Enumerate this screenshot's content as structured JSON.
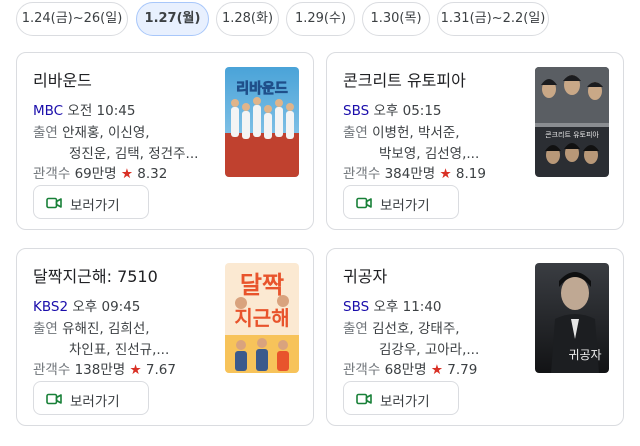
{
  "date_tabs": [
    {
      "label": "1.24(금)~26(일)",
      "active": false
    },
    {
      "label": "1.27(월)",
      "active": true
    },
    {
      "label": "1.28(화)",
      "active": false
    },
    {
      "label": "1.29(수)",
      "active": false
    },
    {
      "label": "1.30(목)",
      "active": false
    },
    {
      "label": "1.31(금)~2.2(일)",
      "active": false
    }
  ],
  "labels": {
    "cast": "출연",
    "audience": "관객수",
    "watch": "보러가기",
    "star": "★"
  },
  "movies": [
    {
      "title": "리바운드",
      "channel": "MBC",
      "time": "오전 10:45",
      "cast_line1": "안재홍, 이신영,",
      "cast_line2": "정진운, 김택, 정건주...",
      "audience": "69만명",
      "rating": "8.32",
      "poster_text": "리바운드",
      "poster_icon": "rebound-poster"
    },
    {
      "title": "콘크리트 유토피아",
      "channel": "SBS",
      "time": "오후 05:15",
      "cast_line1": "이병헌, 박서준,",
      "cast_line2": "박보영, 김선영,...",
      "audience": "384만명",
      "rating": "8.19",
      "poster_text": "콘크리트 유토피아",
      "poster_icon": "concrete-utopia-poster"
    },
    {
      "title": "달짝지근해: 7510",
      "channel": "KBS2",
      "time": "오후 09:45",
      "cast_line1": "유해진, 김희선,",
      "cast_line2": "차인표, 진선규,...",
      "audience": "138만명",
      "rating": "7.67",
      "poster_text": "달짝 지근해",
      "poster_icon": "dalzzak-poster"
    },
    {
      "title": "귀공자",
      "channel": "SBS",
      "time": "오후 11:40",
      "cast_line1": "김선호, 강태주,",
      "cast_line2": "김강우, 고아라,...",
      "audience": "68만명",
      "rating": "7.79",
      "poster_text": "귀공자",
      "poster_icon": "the-childe-poster"
    }
  ]
}
